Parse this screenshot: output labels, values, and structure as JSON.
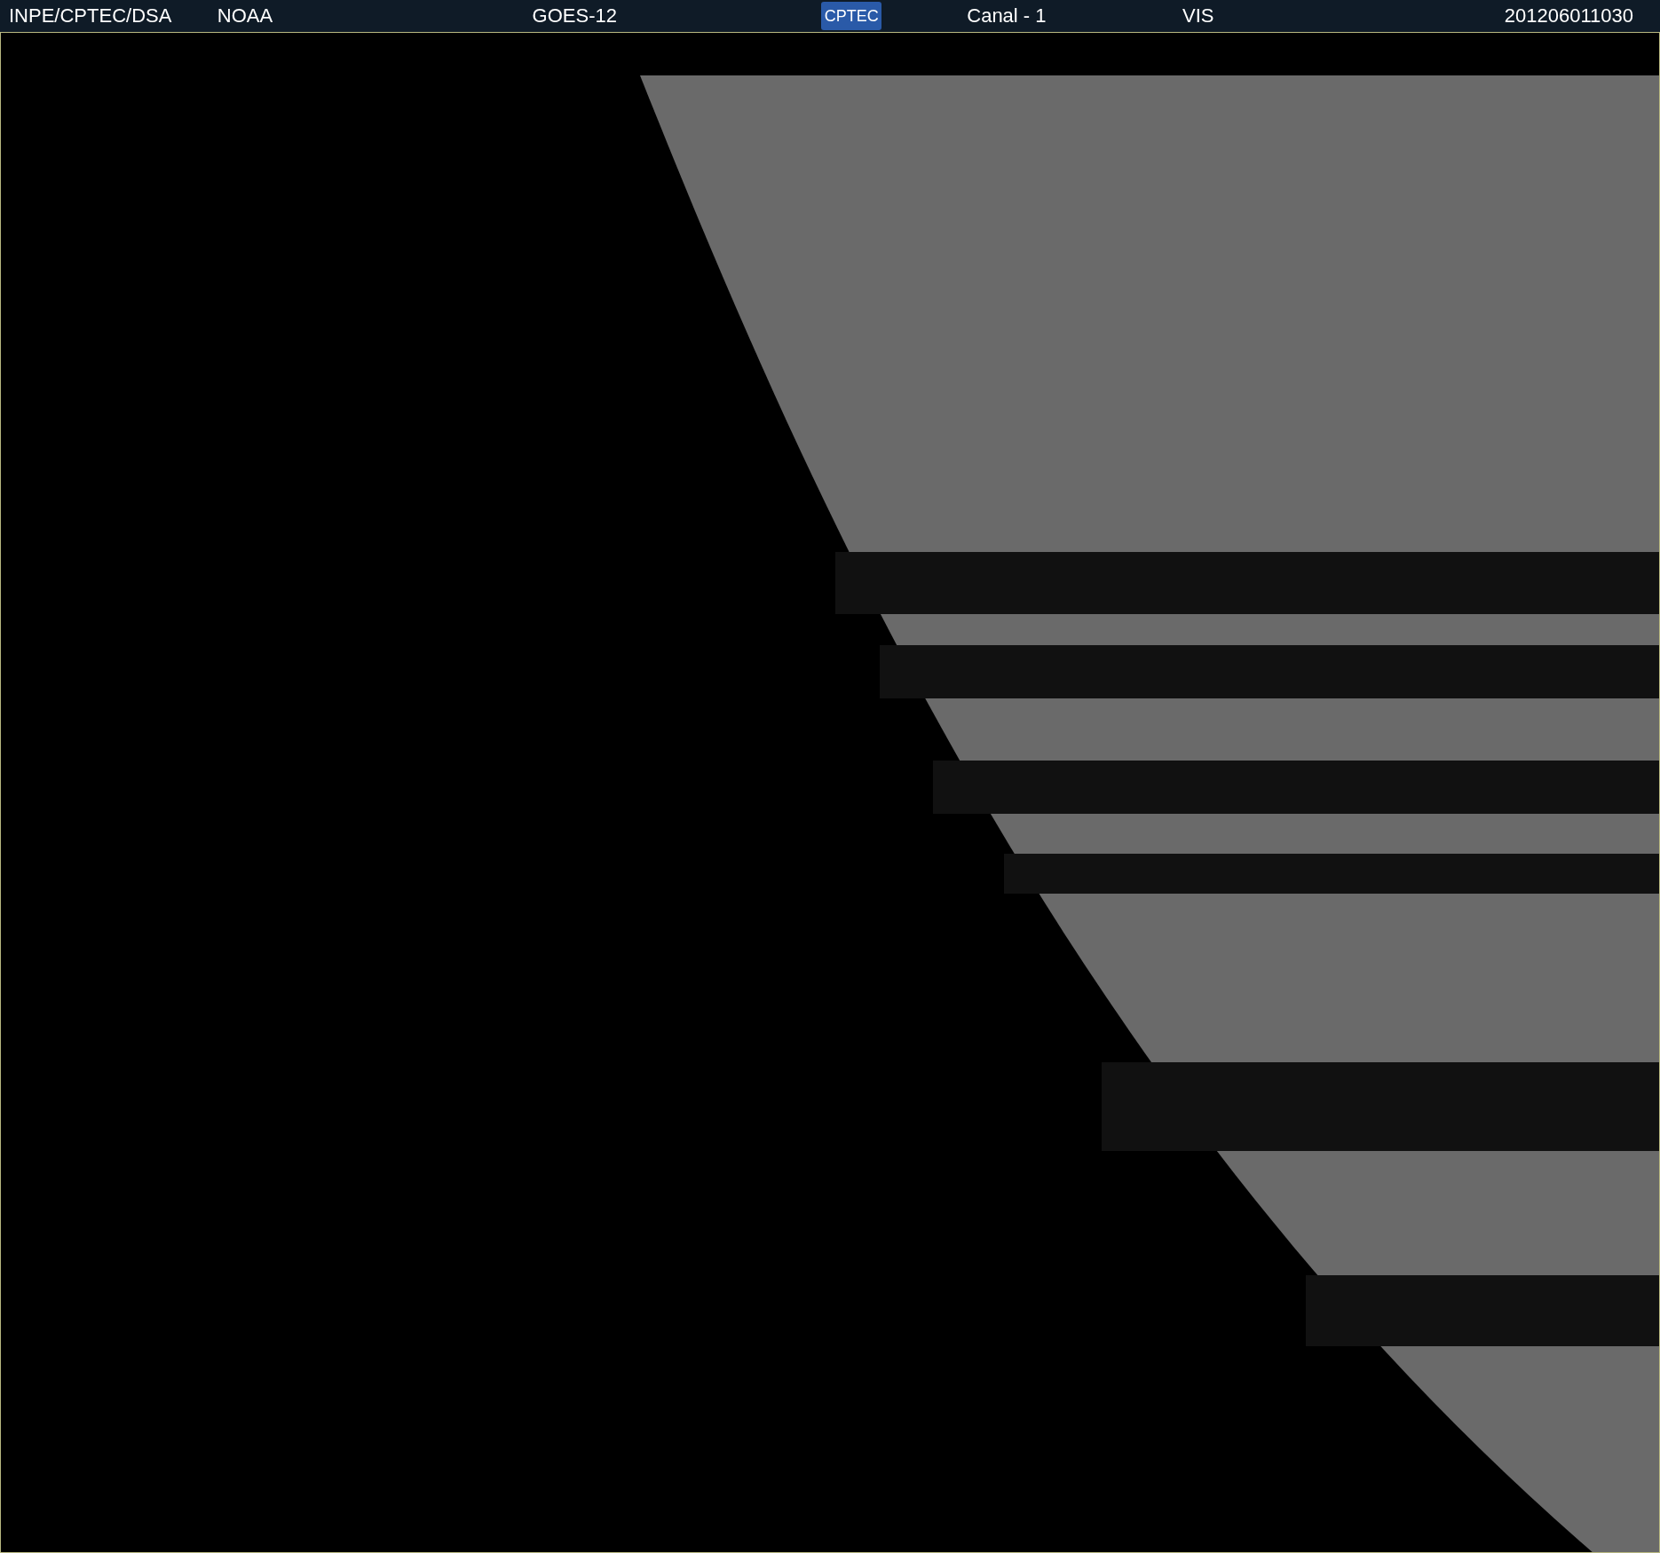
{
  "header": {
    "source": "INPE/CPTEC/DSA",
    "agency": "NOAA",
    "satellite": "GOES-12",
    "logo": "CPTEC",
    "channel": "Canal - 1",
    "band": "VIS",
    "timestamp": "201206011030"
  }
}
